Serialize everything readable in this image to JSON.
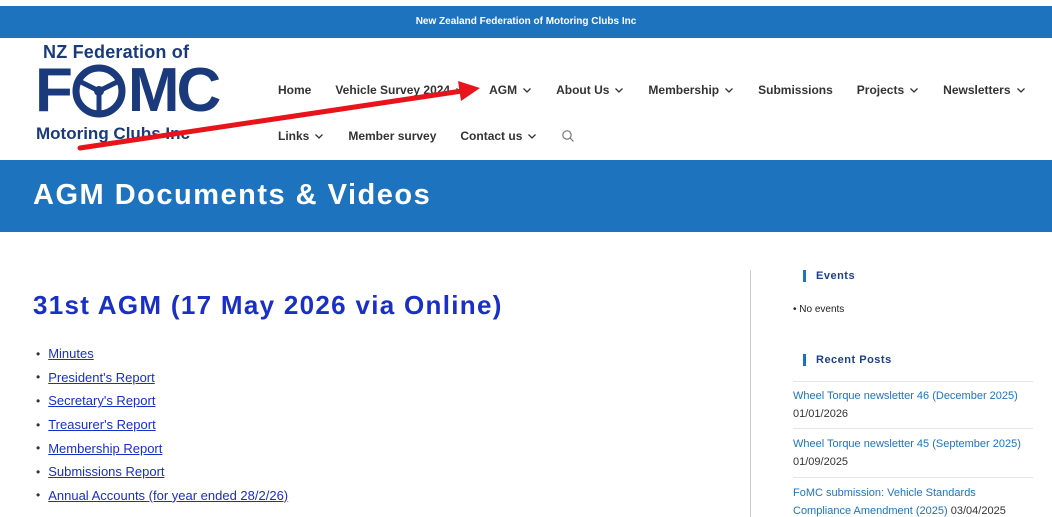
{
  "topbar": {
    "text": "New Zealand Federation of Motoring Clubs Inc"
  },
  "logo": {
    "top_text": "NZ Federation of",
    "big_left": "F",
    "big_right": "MC",
    "bottom_text": "Motoring Clubs Inc"
  },
  "nav": {
    "row1": [
      {
        "label": "Home",
        "has_dropdown": false
      },
      {
        "label": "Vehicle Survey 2024",
        "has_dropdown": true
      },
      {
        "label": "AGM",
        "has_dropdown": true
      },
      {
        "label": "About Us",
        "has_dropdown": true
      },
      {
        "label": "Membership",
        "has_dropdown": true
      },
      {
        "label": "Submissions",
        "has_dropdown": false
      },
      {
        "label": "Projects",
        "has_dropdown": true
      },
      {
        "label": "Newsletters",
        "has_dropdown": true
      }
    ],
    "row2": [
      {
        "label": "Links",
        "has_dropdown": true
      },
      {
        "label": "Member survey",
        "has_dropdown": false
      },
      {
        "label": "Contact us",
        "has_dropdown": true
      }
    ]
  },
  "banner": {
    "title": "AGM Documents & Videos"
  },
  "main": {
    "heading": "31st AGM (17 May 2026 via Online)",
    "documents": [
      "Minutes",
      "President's Report",
      "Secretary's Report",
      "Treasurer's Report",
      "Membership Report",
      "Submissions Report",
      "Annual Accounts (for year ended 28/2/26)"
    ]
  },
  "sidebar": {
    "events_title": "Events",
    "events_empty": "No events",
    "posts_title": "Recent Posts",
    "posts": [
      {
        "title": "Wheel Torque newsletter 46 (December 2025)",
        "date": "01/01/2026"
      },
      {
        "title": "Wheel Torque newsletter 45 (September 2025)",
        "date": "01/09/2025"
      },
      {
        "title": "FoMC submission: Vehicle Standards Compliance Amendment (2025)",
        "date": "03/04/2025"
      }
    ]
  },
  "colors": {
    "brand_blue": "#1e73be",
    "logo_navy": "#1a3a7c",
    "heading_blue": "#1a2fc6",
    "annotation_red": "#e8141b"
  }
}
